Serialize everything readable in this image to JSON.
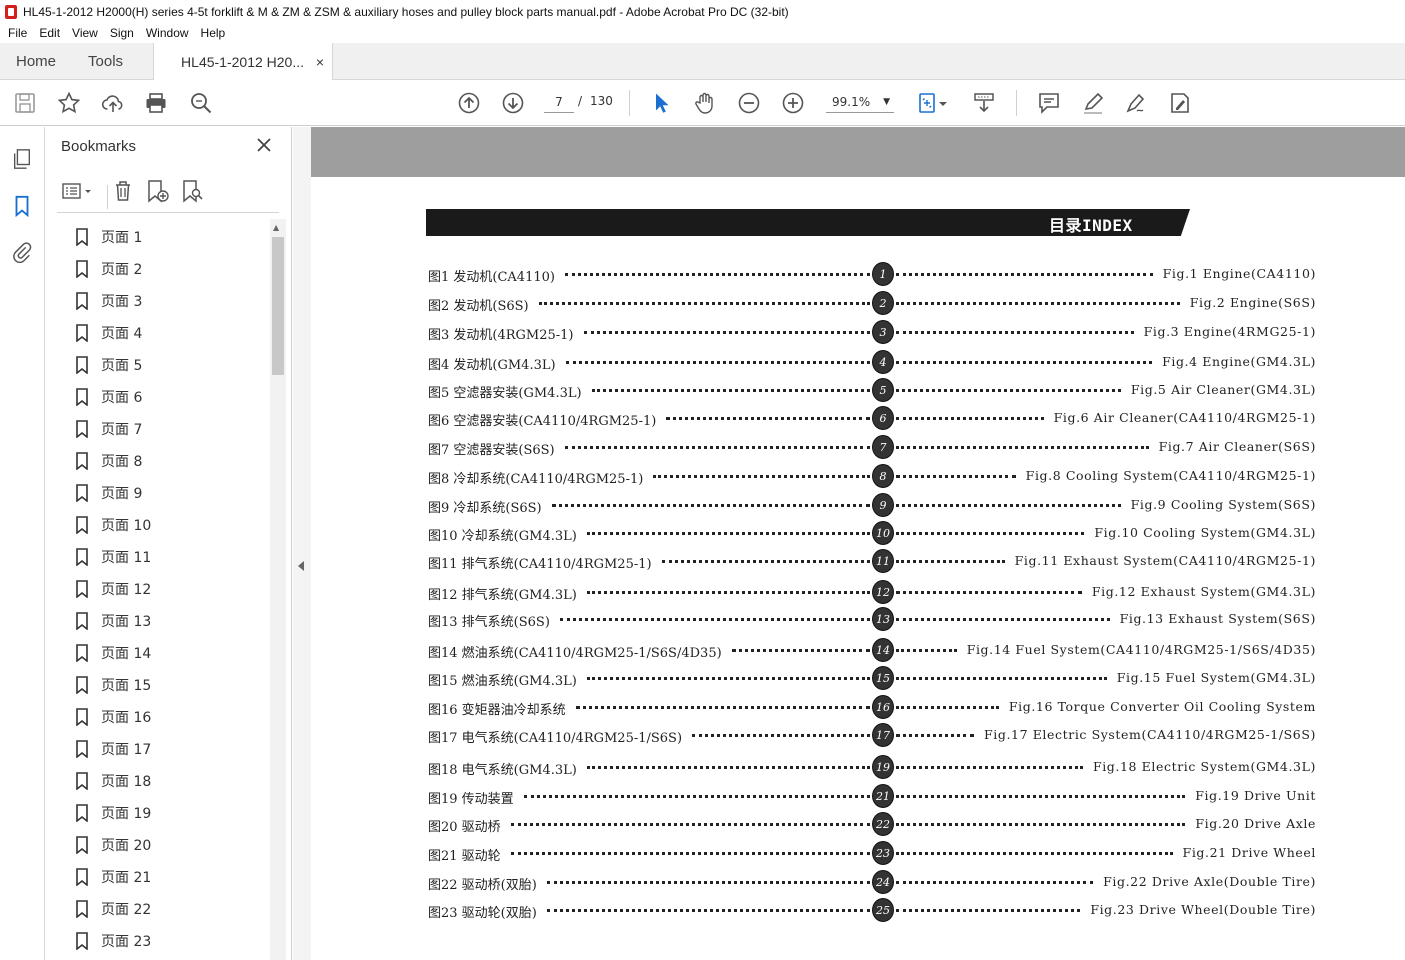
{
  "window": {
    "title": "HL45-1-2012 H2000(H) series 4-5t forklift & M & ZM & ZSM & auxiliary hoses and pulley block parts manual.pdf - Adobe Acrobat Pro DC (32-bit)"
  },
  "menu": [
    "File",
    "Edit",
    "View",
    "Sign",
    "Window",
    "Help"
  ],
  "tabs": {
    "home": "Home",
    "tools": "Tools",
    "document": "HL45-1-2012 H20...",
    "close": "×"
  },
  "toolbar": {
    "page_current": "7",
    "page_separator": "/",
    "page_total": "130",
    "zoom": "99.1%"
  },
  "bookmarks": {
    "title": "Bookmarks",
    "items": [
      "页面 1",
      "页面 2",
      "页面 3",
      "页面 4",
      "页面 5",
      "页面 6",
      "页面 7",
      "页面 8",
      "页面 9",
      "页面 10",
      "页面 11",
      "页面 12",
      "页面 13",
      "页面 14",
      "页面 15",
      "页面 16",
      "页面 17",
      "页面 18",
      "页面 19",
      "页面 20",
      "页面 21",
      "页面 22",
      "页面 23"
    ]
  },
  "document": {
    "banner": "目录INDEX",
    "rows": [
      {
        "zh": "图1  发动机(CA4110)",
        "num": "1",
        "en": "Fig.1 Engine(CA4110)"
      },
      {
        "zh": "图2  发动机(S6S)",
        "num": "2",
        "en": "Fig.2 Engine(S6S)"
      },
      {
        "zh": "图3  发动机(4RGM25-1)",
        "num": "3",
        "en": "Fig.3 Engine(4RMG25-1)"
      },
      {
        "zh": "图4  发动机(GM4.3L)",
        "num": "4",
        "en": "Fig.4 Engine(GM4.3L)"
      },
      {
        "zh": "图5  空滤器安装(GM4.3L)",
        "num": "5",
        "en": "Fig.5 Air Cleaner(GM4.3L)"
      },
      {
        "zh": "图6  空滤器安装(CA4110/4RGM25-1)",
        "num": "6",
        "en": "Fig.6 Air Cleaner(CA4110/4RGM25-1)"
      },
      {
        "zh": "图7  空滤器安装(S6S)",
        "num": "7",
        "en": "Fig.7 Air Cleaner(S6S)"
      },
      {
        "zh": "图8  冷却系统(CA4110/4RGM25-1)",
        "num": "8",
        "en": "Fig.8 Cooling System(CA4110/4RGM25-1)"
      },
      {
        "zh": "图9  冷却系统(S6S)",
        "num": "9",
        "en": "Fig.9 Cooling System(S6S)"
      },
      {
        "zh": "图10 冷却系统(GM4.3L)",
        "num": "10",
        "en": "Fig.10 Cooling System(GM4.3L)"
      },
      {
        "zh": "图11 排气系统(CA4110/4RGM25-1)",
        "num": "11",
        "en": "Fig.11 Exhaust System(CA4110/4RGM25-1)"
      },
      {
        "zh": "图12 排气系统(GM4.3L)",
        "num": "12",
        "en": "Fig.12 Exhaust System(GM4.3L)"
      },
      {
        "zh": "图13 排气系统(S6S)",
        "num": "13",
        "en": "Fig.13 Exhaust System(S6S)"
      },
      {
        "zh": "图14 燃油系统(CA4110/4RGM25-1/S6S/4D35)",
        "num": "14",
        "en": "Fig.14 Fuel System(CA4110/4RGM25-1/S6S/4D35)"
      },
      {
        "zh": "图15 燃油系统(GM4.3L)",
        "num": "15",
        "en": "Fig.15 Fuel System(GM4.3L)"
      },
      {
        "zh": "图16 变矩器油冷却系统",
        "num": "16",
        "en": "Fig.16 Torque Converter Oil Cooling System"
      },
      {
        "zh": "图17 电气系统(CA4110/4RGM25-1/S6S)",
        "num": "17",
        "en": "Fig.17 Electric System(CA4110/4RGM25-1/S6S)"
      },
      {
        "zh": "图18 电气系统(GM4.3L)",
        "num": "19",
        "en": "Fig.18 Electric System(GM4.3L)"
      },
      {
        "zh": "图19 传动装置",
        "num": "21",
        "en": "Fig.19 Drive Unit"
      },
      {
        "zh": "图20 驱动桥",
        "num": "22",
        "en": "Fig.20 Drive Axle"
      },
      {
        "zh": "图21 驱动轮",
        "num": "23",
        "en": "Fig.21 Drive Wheel"
      },
      {
        "zh": "图22 驱动桥(双胎)",
        "num": "24",
        "en": "Fig.22 Drive Axle(Double Tire)"
      },
      {
        "zh": "图23 驱动轮(双胎)",
        "num": "25",
        "en": "Fig.23 Drive Wheel(Double Tire)"
      }
    ]
  },
  "colors": {
    "acrobat_red": "#d4201b",
    "icon_blue": "#1a6fd1",
    "banner_black": "#1a1a1a",
    "doc_gray": "#9e9e9e"
  }
}
